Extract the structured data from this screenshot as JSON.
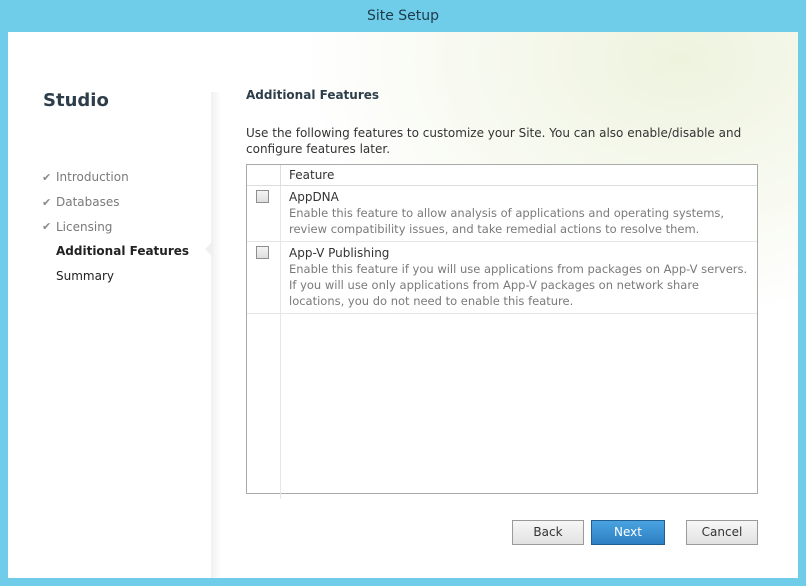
{
  "window": {
    "title": "Site Setup"
  },
  "sidebar": {
    "app_name": "Studio",
    "steps": [
      {
        "label": "Introduction",
        "status": "done"
      },
      {
        "label": "Databases",
        "status": "done"
      },
      {
        "label": "Licensing",
        "status": "done"
      },
      {
        "label": "Additional Features",
        "status": "current"
      },
      {
        "label": "Summary",
        "status": "pending"
      }
    ],
    "check_glyph": "✔"
  },
  "main": {
    "heading": "Additional Features",
    "description": "Use the following features to customize your Site.  You can also enable/disable and configure features later.",
    "table": {
      "column_header": "Feature",
      "rows": [
        {
          "name": "AppDNA",
          "description": "Enable this feature to allow analysis of applications and operating systems, review compatibility issues, and take remedial actions to resolve them.",
          "checked": false
        },
        {
          "name": "App-V Publishing",
          "description": "Enable this feature if you will use applications from packages on App-V servers. If you will use only applications from App-V packages on network share locations, you do not need to enable this feature.",
          "checked": false
        }
      ]
    }
  },
  "buttons": {
    "back": "Back",
    "next": "Next",
    "cancel": "Cancel"
  },
  "colors": {
    "frame": "#6fcde9",
    "primary_button": "#2c7fc3"
  }
}
